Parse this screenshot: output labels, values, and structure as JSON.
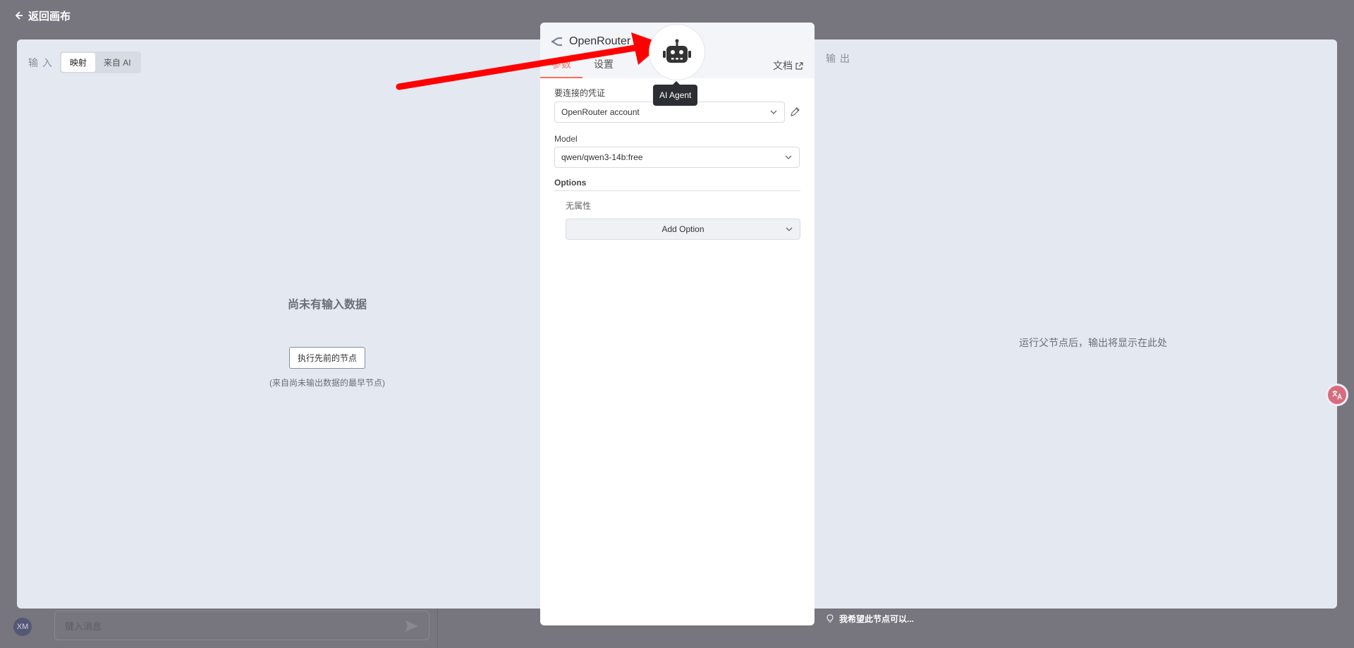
{
  "topbar": {
    "back_label": "返回画布"
  },
  "input_pane": {
    "title": "输 入",
    "mode_tabs": [
      "映射",
      "来自 AI"
    ],
    "empty_title": "尚未有输入数据",
    "exec_button": "执行先前的节点",
    "empty_hint": "(来自尚未输出数据的最早节点)"
  },
  "output_pane": {
    "title": "输 出",
    "empty_text": "运行父节点后，输出将显示在此处"
  },
  "node_panel": {
    "title": "OpenRouter C",
    "tabs": [
      "参数",
      "设置"
    ],
    "docs_label": "文档",
    "credential_label": "要连接的凭证",
    "credential_value": "OpenRouter account",
    "model_label": "Model",
    "model_value": "qwen/qwen3-14b:free",
    "options_label": "Options",
    "no_properties": "无属性",
    "add_option_label": "Add Option"
  },
  "agent": {
    "tooltip": "AI Agent",
    "icon": "robot-icon"
  },
  "chat": {
    "avatar_initials": "XM",
    "input_placeholder": "键入消息",
    "wish_hint": "我希望此节点可以..."
  },
  "colors": {
    "accent": "#ff6d5a",
    "overlay": "#77767e",
    "ndv_bg": "#e4e8f1",
    "arrow": "#ff0000"
  }
}
